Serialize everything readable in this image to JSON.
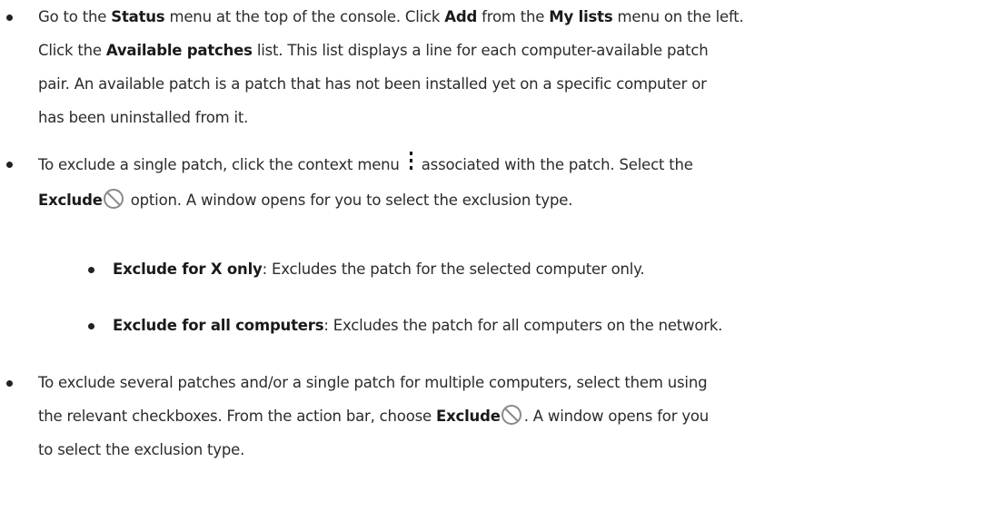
{
  "bullets": {
    "b1": {
      "t1": "Go to the ",
      "k1": "Status",
      "t2": " menu at the top of the console. Click ",
      "k2": "Add",
      "t3": " from the ",
      "k3": "My lists",
      "t4": " menu on the left.",
      "t5": "Click the ",
      "k4": "Available patches",
      "t6": " list. This list displays a line for each computer-available patch",
      "t7": "pair. An available patch is a patch that has not been installed yet on a specific computer or",
      "t8": "has been uninstalled from it."
    },
    "b2": {
      "t1": "To exclude a single patch, click the context menu ",
      "t2": " associated with the patch. Select the",
      "k1": "Exclude",
      "t3": " option. A window opens for you to select the exclusion type."
    },
    "b2a": {
      "k1": "Exclude for X only",
      "t1": ": Excludes the patch for the selected computer only."
    },
    "b2b": {
      "k1": "Exclude for all computers",
      "t1": ": Excludes the patch for all computers on the network."
    },
    "b3": {
      "t1": "To exclude several patches and/or a single patch for multiple computers, select them using",
      "t2": "the relevant checkboxes. From the action bar, choose ",
      "k1": "Exclude",
      "t3": ". A window opens for you",
      "t4": "to select the exclusion type."
    }
  },
  "icons": {
    "context_menu": "vertical-ellipsis-icon",
    "exclude": "prohibited-icon"
  }
}
